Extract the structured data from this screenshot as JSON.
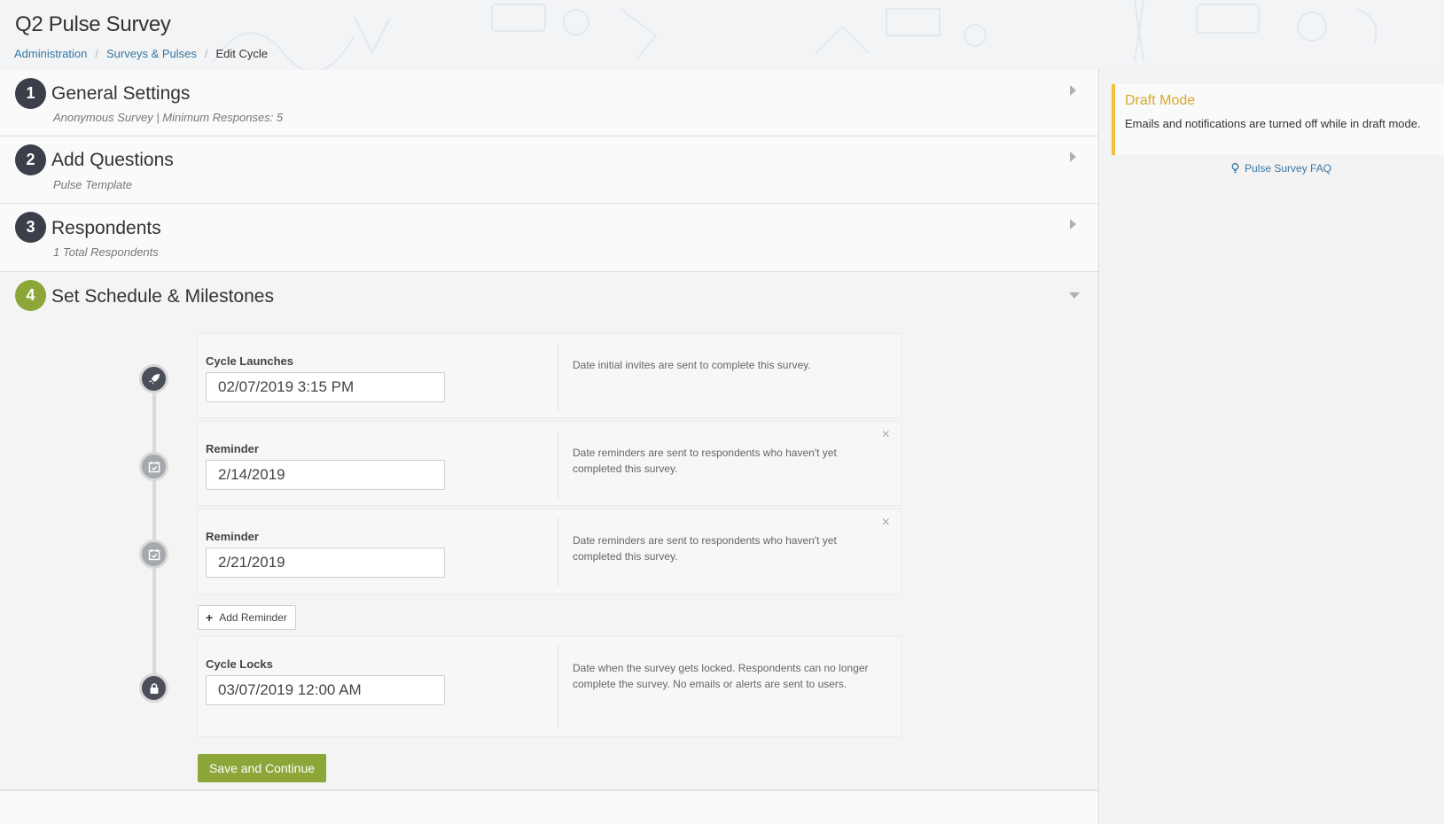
{
  "page": {
    "title": "Q2 Pulse Survey",
    "breadcrumb": [
      {
        "label": "Administration"
      },
      {
        "label": "Surveys & Pulses"
      },
      {
        "label": "Edit Cycle"
      }
    ]
  },
  "sections": [
    {
      "number": "1",
      "title": "General Settings",
      "subtitle": "Anonymous Survey | Minimum Responses: 5"
    },
    {
      "number": "2",
      "title": "Add Questions",
      "subtitle": "Pulse Template"
    },
    {
      "number": "3",
      "title": "Respondents",
      "subtitle": "1 Total Respondents"
    },
    {
      "number": "4",
      "title": "Set Schedule & Milestones"
    }
  ],
  "milestones": {
    "launch": {
      "label": "Cycle Launches",
      "value": "02/07/2019 3:15 PM",
      "description": "Date initial invites are sent to complete this survey.",
      "icon": "rocket-icon"
    },
    "reminders": [
      {
        "label": "Reminder",
        "value": "2/14/2019",
        "description": "Date reminders are sent to respondents who haven't yet completed this survey.",
        "icon": "calendar-check-icon",
        "close": "×"
      },
      {
        "label": "Reminder",
        "value": "2/21/2019",
        "description": "Date reminders are sent to respondents who haven't yet completed this survey.",
        "icon": "calendar-check-icon",
        "close": "×"
      }
    ],
    "add_reminder_label": "Add Reminder",
    "lock": {
      "label": "Cycle Locks",
      "value": "03/07/2019 12:00 AM",
      "description": "Date when the survey gets locked. Respondents can no longer complete the survey. No emails or alerts are sent to users.",
      "icon": "lock-icon"
    },
    "save_label": "Save and Continue"
  },
  "sidebar": {
    "draft_title": "Draft Mode",
    "draft_body": "Emails and notifications are turned off while in draft mode.",
    "faq_label": "Pulse Survey FAQ"
  },
  "colors": {
    "accent_green": "#8ca63a",
    "dark_circle": "#3a3f4a",
    "link_blue": "#3577a5",
    "draft_yellow": "#f0c23a"
  }
}
